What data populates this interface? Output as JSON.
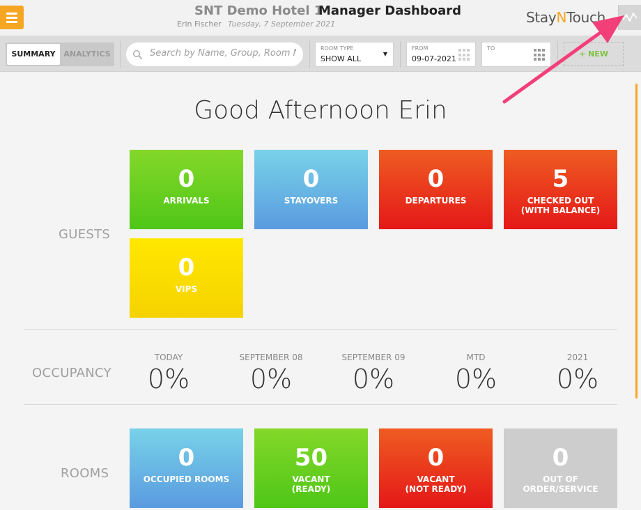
{
  "header": {
    "hotel_name": "SNT Demo Hotel 1",
    "page_title": "Manager Dashboard",
    "user_name": "Erin Fischer",
    "date": "Tuesday, 7 September 2021",
    "logo": {
      "part1": "Stay",
      "part2": "N",
      "part3": "Touch"
    },
    "menu_icon": "hamburger-icon",
    "analytics_icon": "activity-line-icon"
  },
  "toolbar": {
    "tabs": [
      {
        "label": "SUMMARY",
        "active": true
      },
      {
        "label": "ANALYTICS",
        "active": false
      }
    ],
    "search": {
      "placeholder": "Search by Name, Group, Room No. or"
    },
    "room_type": {
      "label": "ROOM TYPE",
      "value": "SHOW ALL"
    },
    "from": {
      "label": "FROM",
      "value": "09-07-2021"
    },
    "to": {
      "label": "TO",
      "value": ""
    },
    "add_new": {
      "label": "+ NEW"
    }
  },
  "greeting": "Good Afternoon Erin",
  "sections": {
    "guests": "GUESTS",
    "occupancy": "OCCUPANCY",
    "rooms": "ROOMS"
  },
  "guests": [
    {
      "value": "0",
      "label": "ARRIVALS",
      "color": "#5ccc1e"
    },
    {
      "value": "0",
      "label": "STAYOVERS",
      "color": "#66b3e6"
    },
    {
      "value": "0",
      "label": "DEPARTURES",
      "color": "#e8341c"
    },
    {
      "value": "5",
      "label": "CHECKED OUT\n(WITH BALANCE)",
      "color": "#e8341c"
    },
    {
      "value": "0",
      "label": "VIPS",
      "color": "#fadb00"
    }
  ],
  "occupancy": [
    {
      "label": "TODAY",
      "value": "0%"
    },
    {
      "label": "SEPTEMBER 08",
      "value": "0%"
    },
    {
      "label": "SEPTEMBER 09",
      "value": "0%"
    },
    {
      "label": "MTD",
      "value": "0%"
    },
    {
      "label": "2021",
      "value": "0%"
    }
  ],
  "rooms": [
    {
      "value": "0",
      "label": "OCCUPIED ROOMS",
      "color": "#66b3e6"
    },
    {
      "value": "50",
      "label": "VACANT\n(READY)",
      "color": "#5ccc1e"
    },
    {
      "value": "0",
      "label": "VACANT\n(NOT READY)",
      "color": "#e8341c"
    },
    {
      "value": "0",
      "label": "OUT OF\nORDER/SERVICE",
      "color": "#cdcdcd"
    }
  ],
  "annotation": {
    "arrow_color": "#f23f7a"
  }
}
